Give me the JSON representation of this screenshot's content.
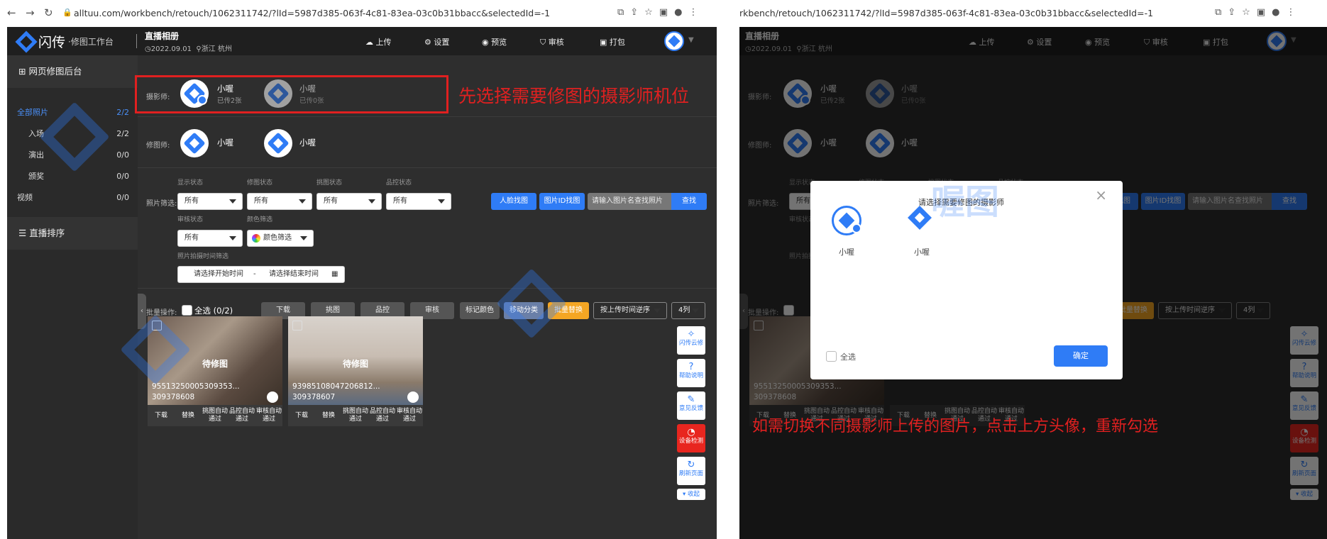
{
  "browser": {
    "url_left": "alltuu.com/workbench/retouch/1062311742/?lId=5987d385-063f-4c81-83ea-03c0b31bbacc&selectedId=-1",
    "url_right": "rkbench/retouch/1062311742/?lId=5987d385-063f-4c81-83ea-03c0b31bbacc&selectedId=-1"
  },
  "app": {
    "logo": "闪传",
    "logo_sub": "·修图工作台",
    "title": "直播相册",
    "date": "2022.09.01",
    "location": "浙江 杭州"
  },
  "nav": {
    "upload": "上传",
    "settings": "设置",
    "preview": "预览",
    "review": "审核",
    "pack": "打包"
  },
  "sidebar": {
    "header": "网页修图后台",
    "items": [
      {
        "label": "全部照片",
        "count": "2/2"
      },
      {
        "label": "入场",
        "count": "2/2"
      },
      {
        "label": "演出",
        "count": "0/0"
      },
      {
        "label": "颁奖",
        "count": "0/0"
      },
      {
        "label": "视频",
        "count": "0/0"
      }
    ],
    "live_sort": "直播排序"
  },
  "photographer": {
    "label": "摄影师:",
    "p1": {
      "name": "小喔",
      "note": "已传2张"
    },
    "p2": {
      "name": "小喔",
      "note": "已传0张"
    }
  },
  "retoucher": {
    "label": "修图师:",
    "r1": "小喔",
    "r2": "小喔"
  },
  "filter": {
    "label": "照片筛选:",
    "display": "显示状态",
    "retouch": "修图状态",
    "pick": "挑图状态",
    "qc": "品控状态",
    "review": "审核状态",
    "color": "颜色筛选",
    "time": "照片拍摄时间筛选",
    "all": "所有",
    "color_val": "颜色筛选",
    "start": "请选择开始时间",
    "dash": "-",
    "end": "请选择结束时间",
    "face": "人脸找图",
    "photo_id": "图片ID找图",
    "search_placeholder": "请输入图片名查找照片",
    "search": "查找"
  },
  "batch": {
    "label": "批量操作:",
    "select_all": "全选",
    "count": "(0/2)",
    "download": "下载",
    "pick": "挑图",
    "qc": "品控",
    "review": "审核",
    "mark": "标记颜色",
    "move": "移动分类",
    "replace": "批量替换",
    "sort": "按上传时间逆序",
    "cols": "4列"
  },
  "photos": [
    {
      "status": "待修图",
      "name1": "95513250005309353...",
      "name2": "309378608"
    },
    {
      "status": "待修图",
      "name1": "93985108047206812...",
      "name2": "309378607"
    }
  ],
  "photo_ops": [
    "下载",
    "替换",
    "挑图自动通过",
    "品控自动通过",
    "审核自动通过"
  ],
  "tools": {
    "cloud": "闪传云修",
    "help": "帮助说明",
    "feedback": "意见反馈",
    "check": "设备检测",
    "refresh": "刷新页面",
    "fold": "收起"
  },
  "annot": {
    "left": "先选择需要修图的摄影师机位",
    "right": "如需切换不同摄影师上传的图片，点击上方头像，重新勾选"
  },
  "modal": {
    "title": "请选择需要修图的摄影师",
    "p1": "小喔",
    "p2": "小喔",
    "select_all": "全选",
    "ok": "确定"
  },
  "watermark": "喔图"
}
